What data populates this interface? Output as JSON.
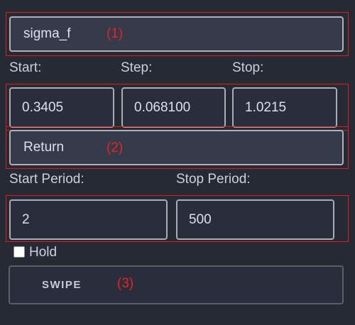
{
  "variable_select": {
    "value": "sigma_f"
  },
  "range": {
    "start_label": "Start:",
    "step_label": "Step:",
    "stop_label": "Stop:",
    "start_value": "0.3405",
    "step_value": "0.068100",
    "stop_value": "1.0215"
  },
  "output_select": {
    "value": "Return"
  },
  "period": {
    "start_label": "Start Period:",
    "stop_label": "Stop Period:",
    "start_value": "2",
    "stop_value": "500"
  },
  "hold": {
    "label": "Hold",
    "checked": false
  },
  "swipe_button": {
    "label": "SWIPE"
  },
  "annotations": {
    "one": "(1)",
    "two": "(2)",
    "three": "(3)"
  },
  "colors": {
    "background": "#262a35",
    "annotation": "#e01d1d",
    "field_border": "#a9adb5",
    "select_bg": "#363b4b"
  }
}
